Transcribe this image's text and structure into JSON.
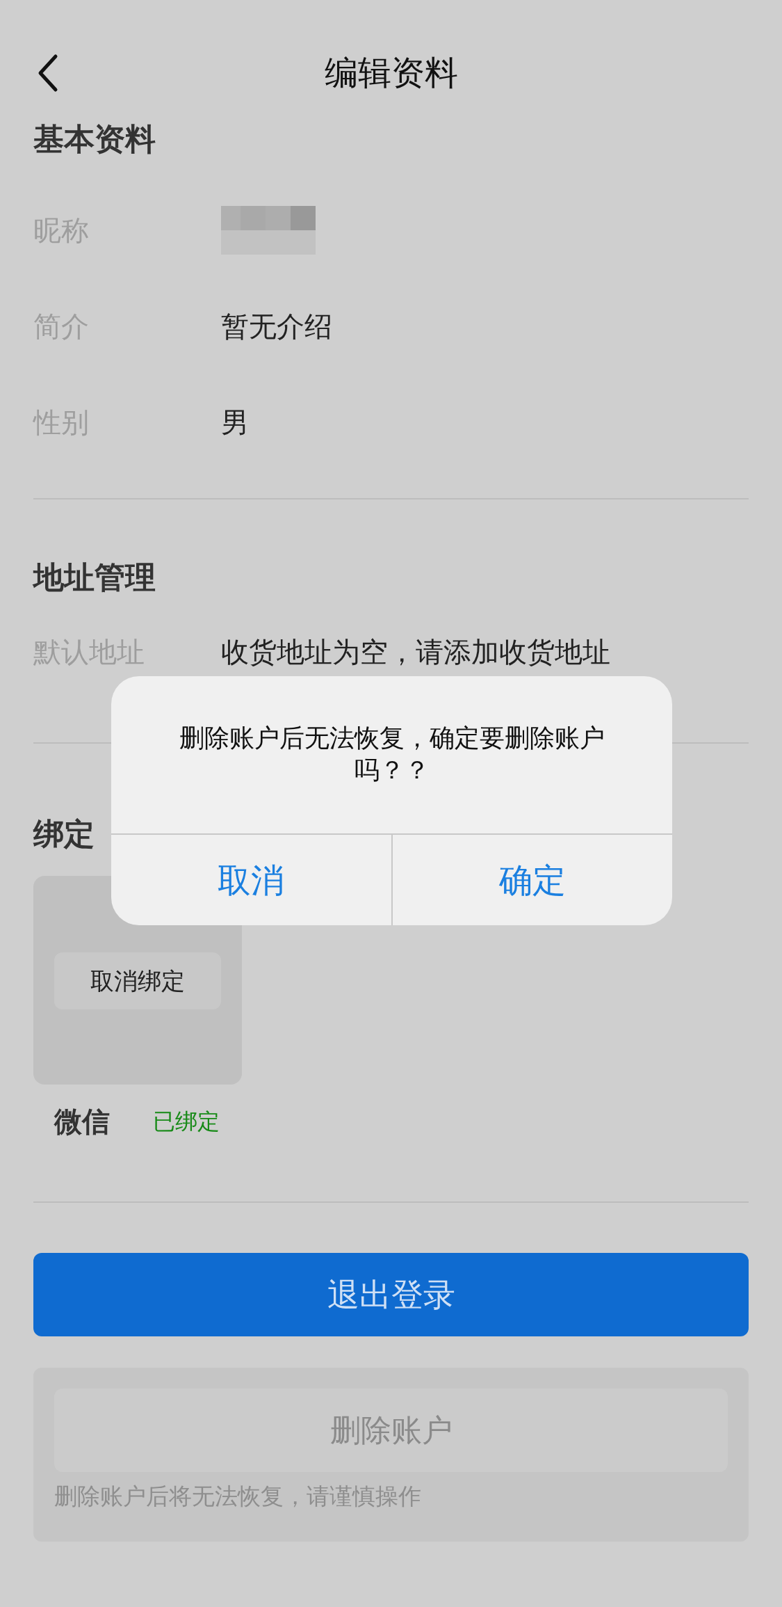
{
  "header": {
    "title": "编辑资料"
  },
  "basic_info": {
    "heading": "基本资料",
    "rows": [
      {
        "label": "昵称",
        "kind": "redacted"
      },
      {
        "label": "简介",
        "kind": "text",
        "value": "暂无介绍"
      },
      {
        "label": "性别",
        "kind": "text",
        "value": "男"
      }
    ]
  },
  "address": {
    "heading": "地址管理",
    "label": "默认地址",
    "value": "收货地址为空，请添加收货地址"
  },
  "bindings": {
    "heading": "绑定",
    "accounts": [
      {
        "unbind_button": "取消绑定",
        "name": "微信",
        "status": "已绑定",
        "bound": true
      }
    ]
  },
  "logout_button": "退出登录",
  "delete": {
    "button": "删除账户",
    "note": "删除账户后将无法恢复，请谨慎操作"
  },
  "dialog": {
    "message": "删除账户后无法恢复，确定要删除账户吗？？",
    "buttons": [
      "取消",
      "确定"
    ]
  }
}
